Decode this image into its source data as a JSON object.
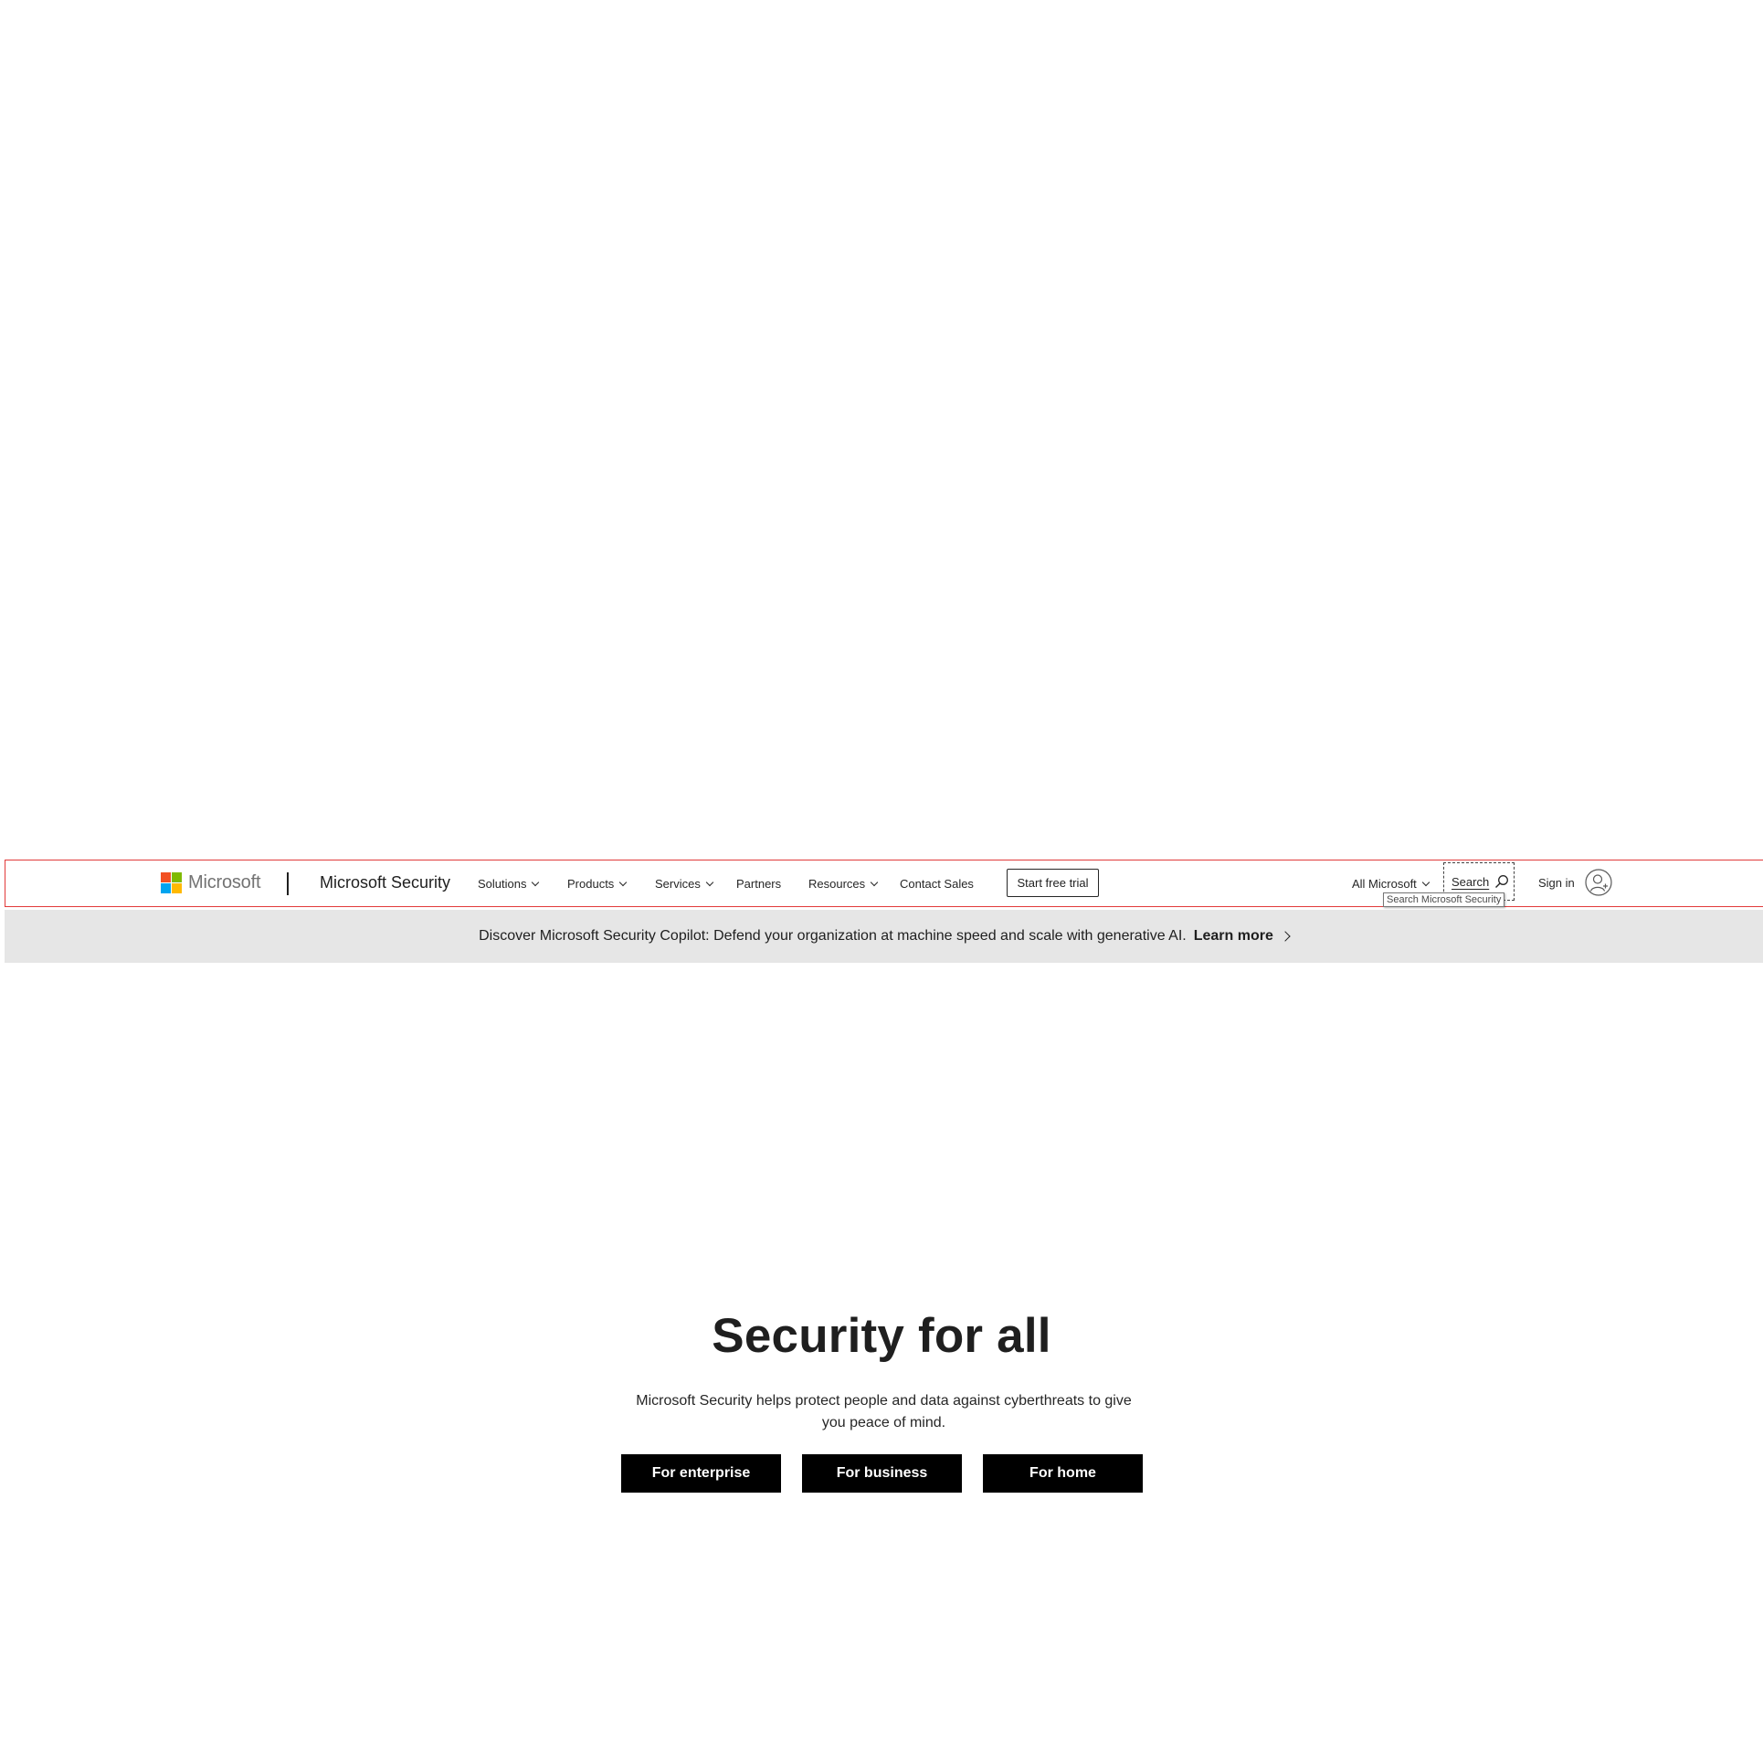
{
  "header": {
    "logo_text": "Microsoft",
    "logo_colors": [
      "#f25022",
      "#7fba00",
      "#00a4ef",
      "#ffb900"
    ],
    "brand": "Microsoft Security",
    "nav": {
      "solutions": "Solutions",
      "products": "Products",
      "services": "Services",
      "partners": "Partners",
      "resources": "Resources",
      "contact_sales": "Contact Sales"
    },
    "trial_button": "Start free trial",
    "all_microsoft": "All Microsoft",
    "search_label": "Search",
    "search_tooltip": "Search Microsoft Security",
    "sign_in": "Sign in",
    "accent_outline_color": "#e13a3a"
  },
  "banner": {
    "text": "Discover Microsoft Security Copilot: Defend your organization at machine speed and scale with generative AI.",
    "link": "Learn more",
    "background": "#e6e6e6"
  },
  "hero": {
    "title": "Security for all",
    "subtitle": "Microsoft Security helps protect people and data against cyberthreats to give you peace of mind.",
    "buttons": {
      "enterprise": "For enterprise",
      "business": "For business",
      "home": "For home"
    }
  }
}
